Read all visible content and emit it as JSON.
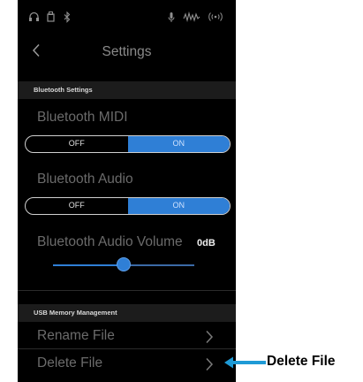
{
  "status_bar": {
    "icons": [
      "headphones-icon",
      "usb-icon",
      "bluetooth-icon",
      "microphone-icon",
      "audio-wave-icon",
      "wireless-signal-icon"
    ]
  },
  "header": {
    "back_icon": "chevron-left-icon",
    "title": "Settings"
  },
  "bluetooth_settings": {
    "section_title": "Bluetooth Settings",
    "midi": {
      "label": "Bluetooth MIDI",
      "off_label": "OFF",
      "on_label": "ON",
      "selected": "ON"
    },
    "audio": {
      "label": "Bluetooth Audio",
      "off_label": "OFF",
      "on_label": "ON",
      "selected": "ON"
    },
    "volume": {
      "label": "Bluetooth Audio Volume",
      "value_text": "0dB",
      "slider_fraction": 0.5
    }
  },
  "usb_memory": {
    "section_title": "USB Memory Management",
    "items": [
      {
        "label": "Rename File",
        "icon": "chevron-right-icon"
      },
      {
        "label": "Delete File",
        "icon": "chevron-right-icon"
      }
    ]
  },
  "callout": {
    "text": "Delete File",
    "arrow_icon": "arrow-left-icon",
    "color": "#1e9ad6"
  },
  "colors": {
    "accent": "#2f7fd6",
    "background": "#000000"
  }
}
